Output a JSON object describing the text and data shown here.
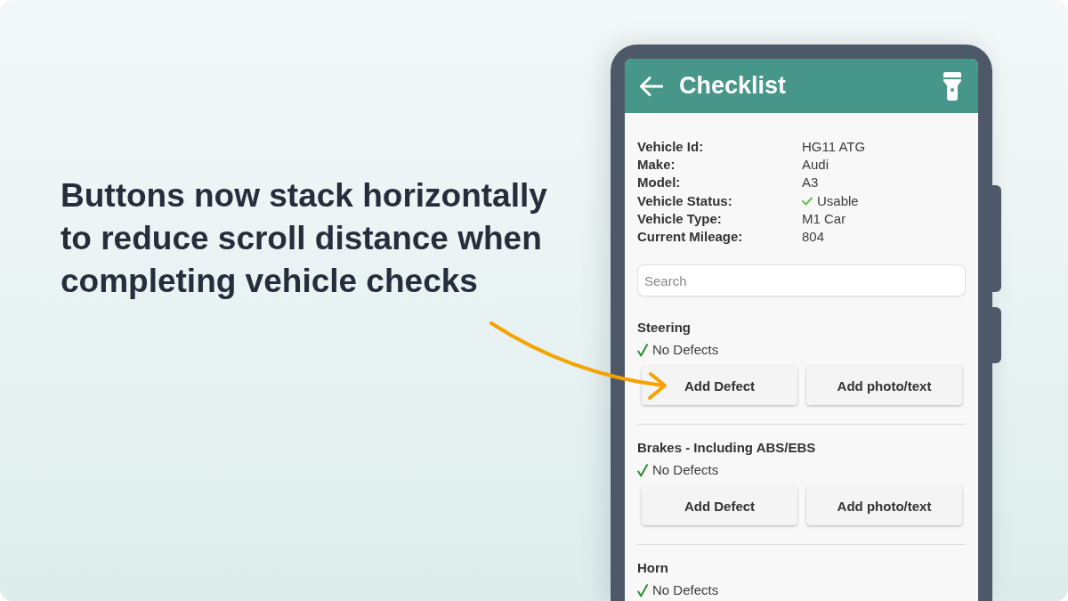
{
  "headline": "Buttons now stack horizontally to reduce scroll distance when completing vehicle checks",
  "phone": {
    "header": {
      "title": "Checklist"
    },
    "vehicle_details": [
      {
        "label": "Vehicle Id:",
        "value": "HG11 ATG",
        "kind": "text"
      },
      {
        "label": "Make:",
        "value": "Audi",
        "kind": "text"
      },
      {
        "label": "Model:",
        "value": "A3",
        "kind": "text"
      },
      {
        "label": "Vehicle Status:",
        "value": "Usable",
        "kind": "status"
      },
      {
        "label": "Vehicle Type:",
        "value": "M1 Car",
        "kind": "text"
      },
      {
        "label": "Current Mileage:",
        "value": "804",
        "kind": "text"
      }
    ],
    "search": {
      "placeholder": "Search"
    },
    "sections": [
      {
        "title": "Steering",
        "ok": true,
        "result": "No Defects",
        "buttons": [
          "Add Defect",
          "Add photo/text"
        ]
      },
      {
        "title": "Brakes - Including ABS/EBS",
        "ok": true,
        "result": "No Defects",
        "buttons": [
          "Add Defect",
          "Add photo/text"
        ]
      },
      {
        "title": "Horn",
        "ok": true,
        "result": "No Defects"
      }
    ]
  }
}
